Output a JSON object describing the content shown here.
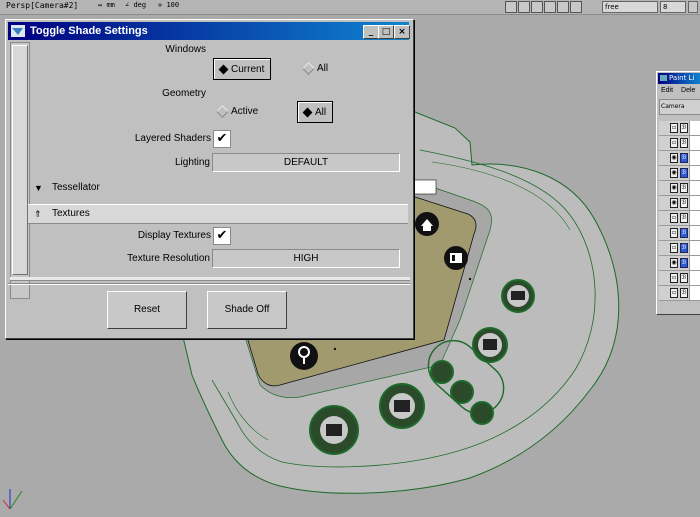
{
  "viewport": {
    "camera_label": "Persp[Camera#2]",
    "unit_linear": "mm",
    "unit_angle": "deg",
    "unit_scale": "100",
    "mode_field": "free",
    "frame_field": "8"
  },
  "dialog": {
    "title": "Toggle Shade Settings",
    "window_buttons": {
      "minimize": "_",
      "maximize": "□",
      "close": "×"
    },
    "windows": {
      "label": "Windows",
      "options": [
        {
          "label": "Current",
          "selected": true
        },
        {
          "label": "All",
          "selected": false
        }
      ]
    },
    "geometry": {
      "label": "Geometry",
      "options": [
        {
          "label": "Active",
          "selected": false
        },
        {
          "label": "All",
          "selected": true
        }
      ]
    },
    "layered_shaders": {
      "label": "Layered Shaders",
      "checked": true,
      "mark": "✔"
    },
    "lighting": {
      "label": "Lighting",
      "value": "DEFAULT"
    },
    "tessellator": {
      "label": "Tessellator",
      "arrow": "▼",
      "expanded": false
    },
    "textures": {
      "label": "Textures",
      "arrow": "⇑",
      "expanded": true
    },
    "display_textures": {
      "label": "Display Textures",
      "checked": true,
      "mark": "✔"
    },
    "texture_resolution": {
      "label": "Texture Resolution",
      "value": "HIGH"
    },
    "buttons": {
      "reset": "Reset",
      "shade_off": "Shade Off"
    }
  },
  "paint_list": {
    "title": "Paint Li",
    "menu": [
      "Edit",
      "Dele"
    ],
    "camera_label": "Camera",
    "rows": [
      {
        "icon": "brush",
        "blue": false
      },
      {
        "icon": "brush",
        "blue": false
      },
      {
        "icon": "eye-brush",
        "blue": true
      },
      {
        "icon": "eye-brush",
        "blue": true
      },
      {
        "icon": "eye-brush",
        "blue": false
      },
      {
        "icon": "eye-brush",
        "blue": false
      },
      {
        "icon": "brush",
        "blue": false
      },
      {
        "icon": "brush",
        "blue": true
      },
      {
        "icon": "brush",
        "blue": true
      },
      {
        "icon": "eye-brush",
        "blue": true
      },
      {
        "icon": "brush",
        "blue": false
      },
      {
        "icon": "brush",
        "blue": false
      }
    ]
  },
  "colors": {
    "title_start": "#000080",
    "title_end": "#1084d0",
    "model_body": "#b9b9b9",
    "model_inlay": "#a19a6e",
    "wire": "#1d6a2a"
  }
}
